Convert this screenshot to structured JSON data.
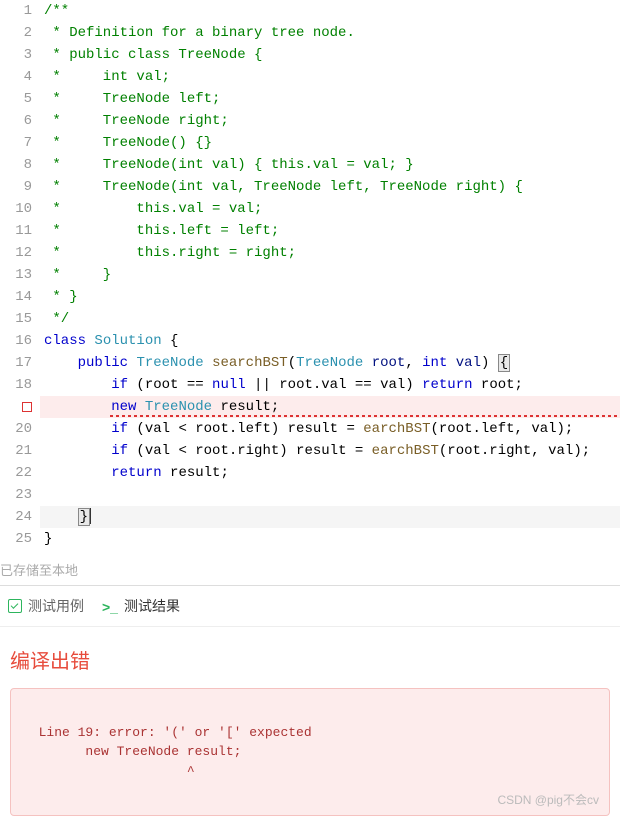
{
  "code_lines": [
    {
      "n": "1",
      "err": false,
      "tokens": [
        {
          "c": "c-comment",
          "t": "/**"
        }
      ]
    },
    {
      "n": "2",
      "err": false,
      "tokens": [
        {
          "c": "c-comment",
          "t": " * Definition for a binary tree node."
        }
      ]
    },
    {
      "n": "3",
      "err": false,
      "tokens": [
        {
          "c": "c-comment",
          "t": " * public class TreeNode {"
        }
      ]
    },
    {
      "n": "4",
      "err": false,
      "tokens": [
        {
          "c": "c-comment",
          "t": " *     int val;"
        }
      ]
    },
    {
      "n": "5",
      "err": false,
      "tokens": [
        {
          "c": "c-comment",
          "t": " *     TreeNode left;"
        }
      ]
    },
    {
      "n": "6",
      "err": false,
      "tokens": [
        {
          "c": "c-comment",
          "t": " *     TreeNode right;"
        }
      ]
    },
    {
      "n": "7",
      "err": false,
      "tokens": [
        {
          "c": "c-comment",
          "t": " *     TreeNode() {}"
        }
      ]
    },
    {
      "n": "8",
      "err": false,
      "tokens": [
        {
          "c": "c-comment",
          "t": " *     TreeNode(int val) { this.val = val; }"
        }
      ]
    },
    {
      "n": "9",
      "err": false,
      "tokens": [
        {
          "c": "c-comment",
          "t": " *     TreeNode(int val, TreeNode left, TreeNode right) {"
        }
      ]
    },
    {
      "n": "10",
      "err": false,
      "tokens": [
        {
          "c": "c-comment",
          "t": " *         this.val = val;"
        }
      ]
    },
    {
      "n": "11",
      "err": false,
      "tokens": [
        {
          "c": "c-comment",
          "t": " *         this.left = left;"
        }
      ]
    },
    {
      "n": "12",
      "err": false,
      "tokens": [
        {
          "c": "c-comment",
          "t": " *         this.right = right;"
        }
      ]
    },
    {
      "n": "13",
      "err": false,
      "tokens": [
        {
          "c": "c-comment",
          "t": " *     }"
        }
      ]
    },
    {
      "n": "14",
      "err": false,
      "tokens": [
        {
          "c": "c-comment",
          "t": " * }"
        }
      ]
    },
    {
      "n": "15",
      "err": false,
      "tokens": [
        {
          "c": "c-comment",
          "t": " */"
        }
      ]
    },
    {
      "n": "16",
      "err": false,
      "tokens": [
        {
          "c": "c-kw",
          "t": "class"
        },
        {
          "c": "",
          "t": " "
        },
        {
          "c": "c-type",
          "t": "Solution"
        },
        {
          "c": "",
          "t": " {"
        }
      ]
    },
    {
      "n": "17",
      "err": false,
      "tokens": [
        {
          "c": "",
          "t": "    "
        },
        {
          "c": "c-kw",
          "t": "public"
        },
        {
          "c": "",
          "t": " "
        },
        {
          "c": "c-type",
          "t": "TreeNode"
        },
        {
          "c": "",
          "t": " "
        },
        {
          "c": "c-method",
          "t": "searchBST"
        },
        {
          "c": "",
          "t": "("
        },
        {
          "c": "c-type",
          "t": "TreeNode"
        },
        {
          "c": "",
          "t": " "
        },
        {
          "c": "c-param",
          "t": "root"
        },
        {
          "c": "",
          "t": ", "
        },
        {
          "c": "c-kw",
          "t": "int"
        },
        {
          "c": "",
          "t": " "
        },
        {
          "c": "c-param",
          "t": "val"
        },
        {
          "c": "",
          "t": ") "
        },
        {
          "c": "brace-hl",
          "t": "{"
        }
      ]
    },
    {
      "n": "18",
      "err": false,
      "tokens": [
        {
          "c": "",
          "t": "        "
        },
        {
          "c": "c-kw",
          "t": "if"
        },
        {
          "c": "",
          "t": " (root == "
        },
        {
          "c": "c-lit",
          "t": "null"
        },
        {
          "c": "",
          "t": " || root.val == val) "
        },
        {
          "c": "c-kw",
          "t": "return"
        },
        {
          "c": "",
          "t": " root;"
        }
      ]
    },
    {
      "n": "ERR",
      "err": true,
      "tokens": [
        {
          "c": "",
          "t": "        "
        },
        {
          "c": "c-kw",
          "t": "new"
        },
        {
          "c": "",
          "t": " "
        },
        {
          "c": "c-type",
          "t": "TreeNode"
        },
        {
          "c": "",
          "t": " result;"
        }
      ]
    },
    {
      "n": "20",
      "err": false,
      "tokens": [
        {
          "c": "",
          "t": "        "
        },
        {
          "c": "c-kw",
          "t": "if"
        },
        {
          "c": "",
          "t": " (val < root.left) result = "
        },
        {
          "c": "c-method",
          "t": "earchBST"
        },
        {
          "c": "",
          "t": "(root.left, val);"
        }
      ]
    },
    {
      "n": "21",
      "err": false,
      "tokens": [
        {
          "c": "",
          "t": "        "
        },
        {
          "c": "c-kw",
          "t": "if"
        },
        {
          "c": "",
          "t": " (val < root.right) result = "
        },
        {
          "c": "c-method",
          "t": "earchBST"
        },
        {
          "c": "",
          "t": "(root.right, val);"
        }
      ]
    },
    {
      "n": "22",
      "err": false,
      "tokens": [
        {
          "c": "",
          "t": "        "
        },
        {
          "c": "c-kw",
          "t": "return"
        },
        {
          "c": "",
          "t": " result;"
        }
      ]
    },
    {
      "n": "23",
      "err": false,
      "tokens": [
        {
          "c": "",
          "t": ""
        }
      ]
    },
    {
      "n": "24",
      "err": false,
      "cursor": true,
      "tokens": [
        {
          "c": "",
          "t": "    "
        },
        {
          "c": "brace-hl",
          "t": "}"
        }
      ]
    },
    {
      "n": "25",
      "err": false,
      "tokens": [
        {
          "c": "",
          "t": "}"
        }
      ]
    }
  ],
  "status_text": "已存储至本地",
  "tabs": {
    "testcase": "测试用例",
    "result": "测试结果"
  },
  "error_title": "编译出错",
  "error_message": "Line 19: error: '(' or '[' expected\n        new TreeNode result;\n                     ^",
  "watermark": "CSDN @pig不会cv"
}
